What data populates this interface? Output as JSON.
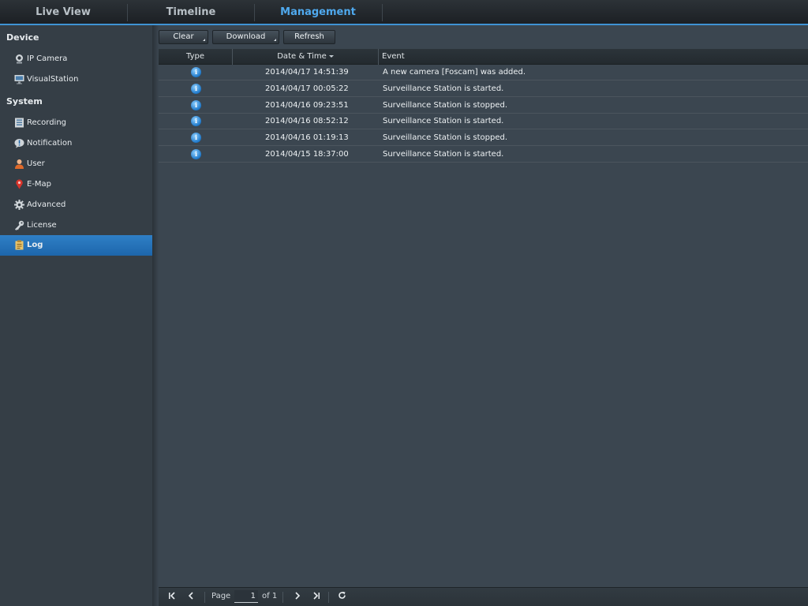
{
  "tabs": [
    {
      "label": "Live View"
    },
    {
      "label": "Timeline"
    },
    {
      "label": "Management"
    }
  ],
  "sidebar": {
    "sections": [
      {
        "title": "Device"
      },
      {
        "title": "System"
      }
    ],
    "items": [
      {
        "label": "IP Camera",
        "icon": "camera-icon"
      },
      {
        "label": "VisualStation",
        "icon": "monitor-icon"
      },
      {
        "label": "Recording",
        "icon": "recording-icon"
      },
      {
        "label": "Notification",
        "icon": "notification-icon"
      },
      {
        "label": "User",
        "icon": "user-icon"
      },
      {
        "label": "E-Map",
        "icon": "map-pin-icon"
      },
      {
        "label": "Advanced",
        "icon": "gear-icon"
      },
      {
        "label": "License",
        "icon": "key-icon"
      },
      {
        "label": "Log",
        "icon": "log-icon"
      }
    ],
    "active": "Log"
  },
  "toolbar": {
    "clear_label": "Clear",
    "download_label": "Download",
    "refresh_label": "Refresh"
  },
  "grid": {
    "columns": [
      "Type",
      "Date & Time",
      "Event"
    ],
    "rows": [
      {
        "type": "info",
        "datetime": "2014/04/17 14:51:39",
        "event": "A new camera [Foscam] was added."
      },
      {
        "type": "info",
        "datetime": "2014/04/17 00:05:22",
        "event": "Surveillance Station is started."
      },
      {
        "type": "info",
        "datetime": "2014/04/16 09:23:51",
        "event": "Surveillance Station is stopped."
      },
      {
        "type": "info",
        "datetime": "2014/04/16 08:52:12",
        "event": "Surveillance Station is started."
      },
      {
        "type": "info",
        "datetime": "2014/04/16 01:19:13",
        "event": "Surveillance Station is stopped."
      },
      {
        "type": "info",
        "datetime": "2014/04/15 18:37:00",
        "event": "Surveillance Station is started."
      }
    ]
  },
  "pager": {
    "page_label": "Page",
    "page_value": "1",
    "of_label": "of 1"
  },
  "colors": {
    "accent": "#3f93d4",
    "active_tab": "#4fa9ee",
    "selected_item": "#2472b8"
  }
}
